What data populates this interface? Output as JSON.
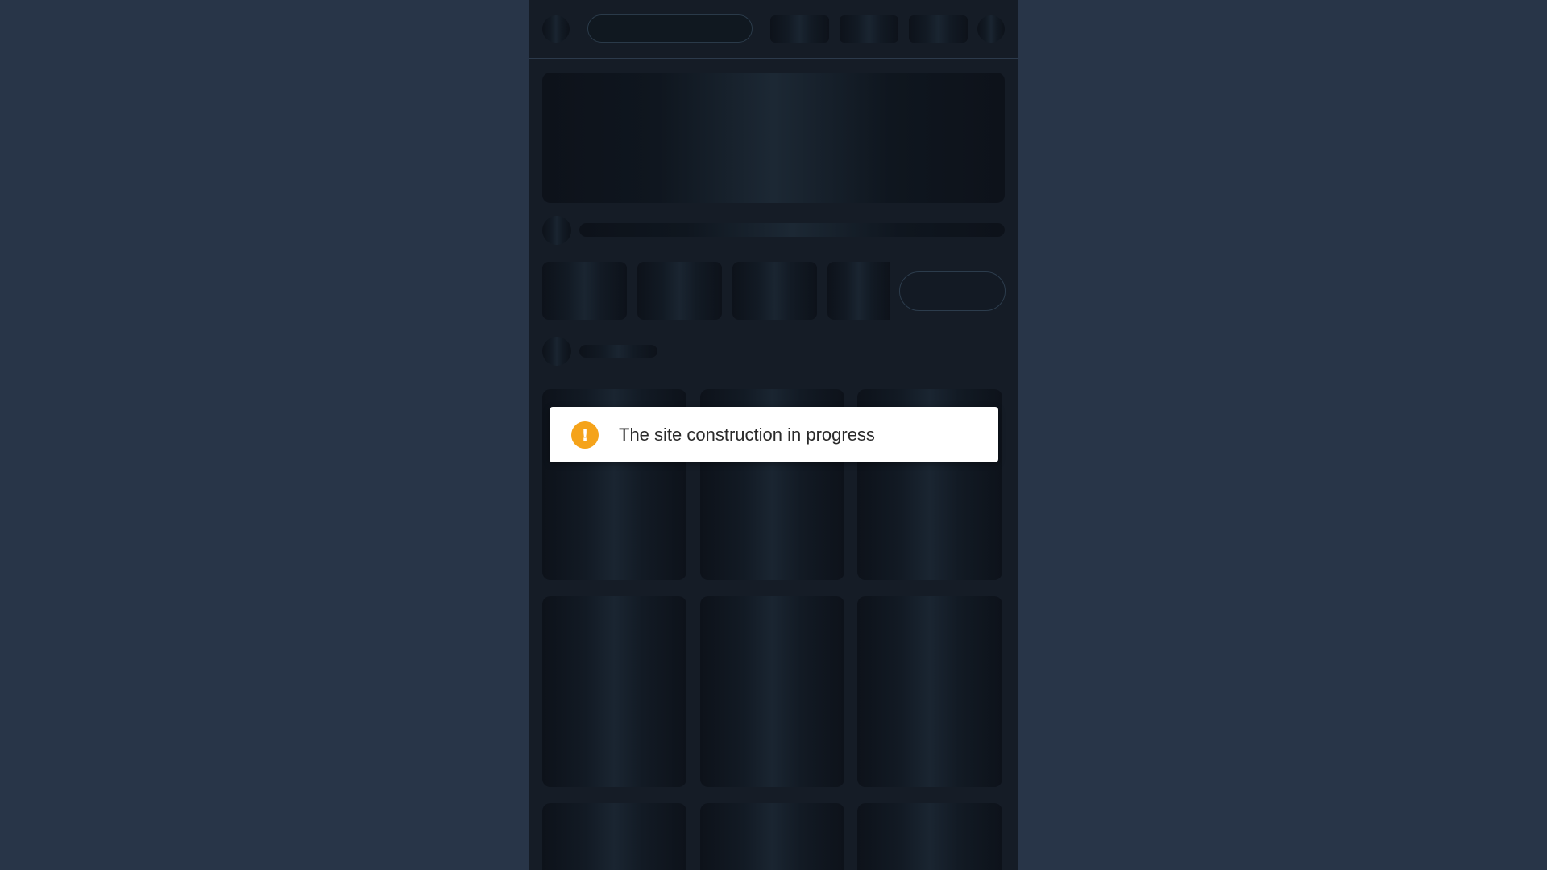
{
  "colors": {
    "page_background": "#283548",
    "app_background": "#151c26",
    "toast_background": "#ffffff",
    "warning_accent": "#f5a31a",
    "toast_text": "#2a2a2a"
  },
  "notification": {
    "icon": "exclamation-warning-icon",
    "icon_glyph": "!",
    "message": "The site construction in progress"
  },
  "skeleton": {
    "state": "loading"
  }
}
